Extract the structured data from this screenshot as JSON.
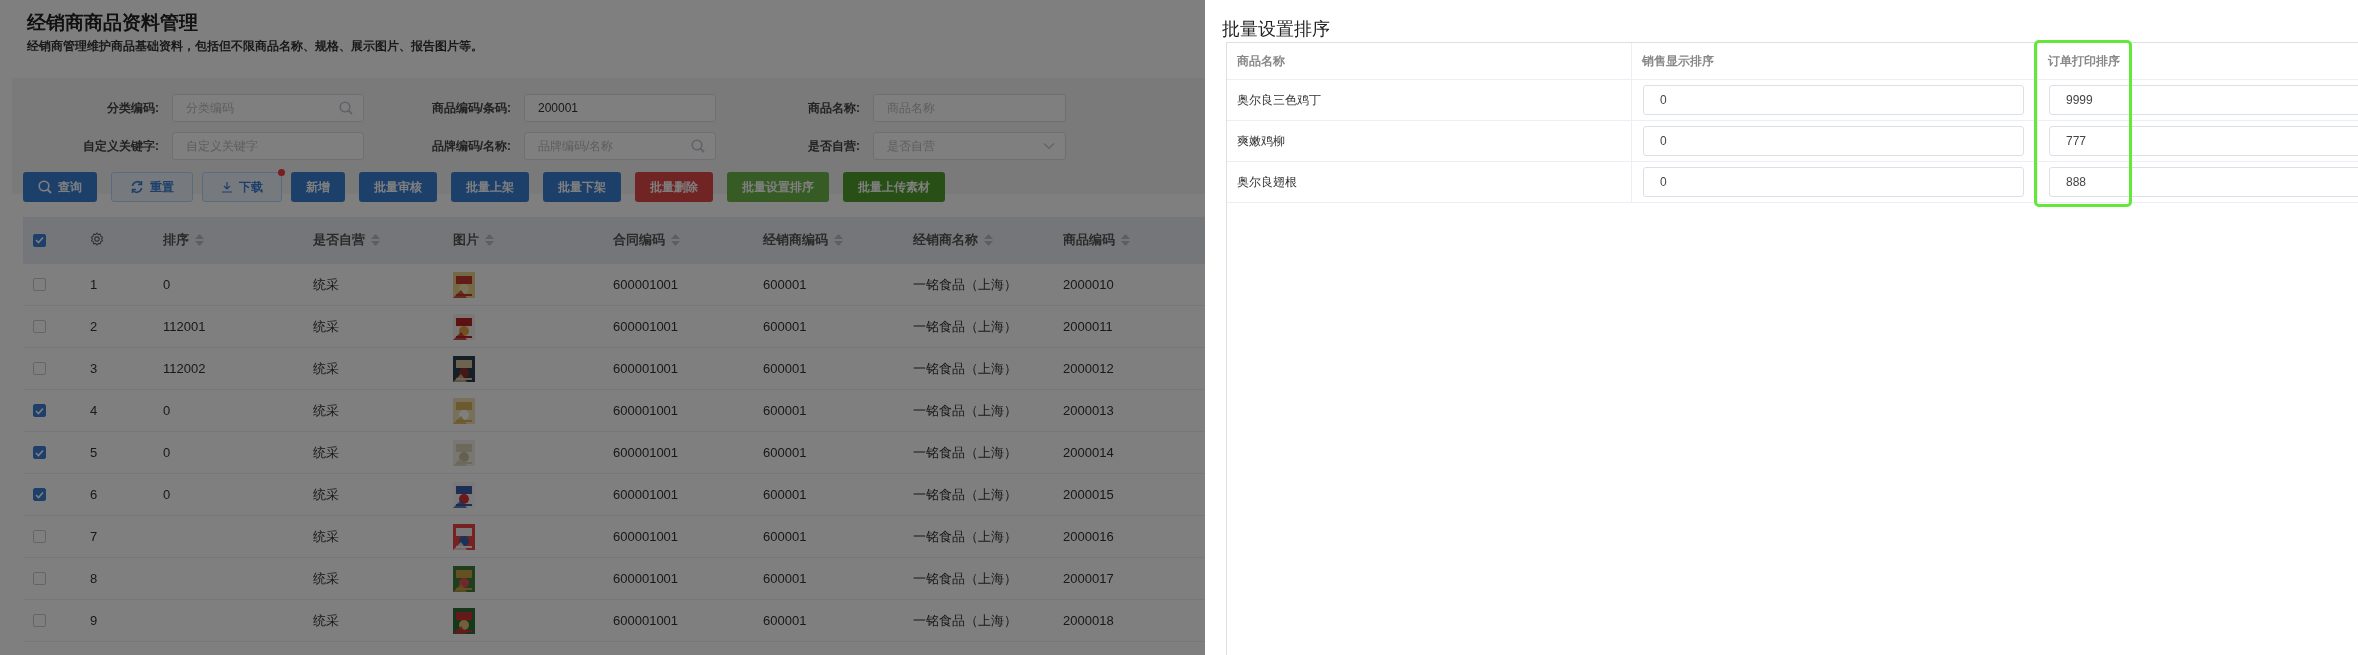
{
  "page": {
    "title": "经销商商品资料管理",
    "subtitle": "经销商管理维护商品基础资料，包括但不限商品名称、规格、展示图片、报告图片等。"
  },
  "filters": [
    {
      "label": "分类编码:",
      "placeholder": "分类编码",
      "kind": "lookup"
    },
    {
      "label": "商品编码/条码:",
      "value": "200001",
      "kind": "text"
    },
    {
      "label": "商品名称:",
      "placeholder": "商品名称",
      "kind": "text"
    },
    {
      "label": "自定义关键字:",
      "placeholder": "自定义关键字",
      "kind": "text"
    },
    {
      "label": "品牌编码/名称:",
      "placeholder": "品牌编码/名称",
      "kind": "lookup"
    },
    {
      "label": "是否自营:",
      "placeholder": "是否自营",
      "kind": "select"
    }
  ],
  "buttons": [
    {
      "label": "查询",
      "kind": "search",
      "color": "#1d406b"
    },
    {
      "label": "重置",
      "kind": "reset"
    },
    {
      "label": "下载",
      "kind": "download",
      "badge": true
    },
    {
      "label": "新增",
      "kind": "solid",
      "color": "#1d406b"
    },
    {
      "label": "批量审核",
      "kind": "solid",
      "color": "#1d406b"
    },
    {
      "label": "批量上架",
      "kind": "solid",
      "color": "#1d406b"
    },
    {
      "label": "批量下架",
      "kind": "solid",
      "color": "#1d406b"
    },
    {
      "label": "批量删除",
      "kind": "solid",
      "color": "#702424"
    },
    {
      "label": "批量设置排序",
      "kind": "solid",
      "color": "#365b25"
    },
    {
      "label": "批量上传素材",
      "kind": "solid",
      "color": "#274f16"
    }
  ],
  "table": {
    "select_all": true,
    "columns": [
      {
        "label": "排序",
        "sortable": true
      },
      {
        "label": "是否自营",
        "sortable": true
      },
      {
        "label": "图片",
        "sortable": true
      },
      {
        "label": "合同编码",
        "sortable": true
      },
      {
        "label": "经销商编码",
        "sortable": true
      },
      {
        "label": "经销商名称",
        "sortable": true
      },
      {
        "label": "商品编码",
        "sortable": true
      }
    ],
    "rows": [
      {
        "checked": false,
        "index": "1",
        "sort": "0",
        "self_run": "统采",
        "contract": "600001001",
        "dealer_code": "600001",
        "dealer_name": "一铭食品（上海）",
        "product_code": "2000010"
      },
      {
        "checked": false,
        "index": "2",
        "sort": "112001",
        "self_run": "统采",
        "contract": "600001001",
        "dealer_code": "600001",
        "dealer_name": "一铭食品（上海）",
        "product_code": "2000011"
      },
      {
        "checked": false,
        "index": "3",
        "sort": "112002",
        "self_run": "统采",
        "contract": "600001001",
        "dealer_code": "600001",
        "dealer_name": "一铭食品（上海）",
        "product_code": "2000012"
      },
      {
        "checked": true,
        "index": "4",
        "sort": "0",
        "self_run": "统采",
        "contract": "600001001",
        "dealer_code": "600001",
        "dealer_name": "一铭食品（上海）",
        "product_code": "2000013"
      },
      {
        "checked": true,
        "index": "5",
        "sort": "0",
        "self_run": "统采",
        "contract": "600001001",
        "dealer_code": "600001",
        "dealer_name": "一铭食品（上海）",
        "product_code": "2000014"
      },
      {
        "checked": true,
        "index": "6",
        "sort": "0",
        "self_run": "统采",
        "contract": "600001001",
        "dealer_code": "600001",
        "dealer_name": "一铭食品（上海）",
        "product_code": "2000015"
      },
      {
        "checked": false,
        "index": "7",
        "self_run": "统采",
        "contract": "600001001",
        "dealer_code": "600001",
        "dealer_name": "一铭食品（上海）",
        "product_code": "2000016"
      },
      {
        "checked": false,
        "index": "8",
        "self_run": "统采",
        "contract": "600001001",
        "dealer_code": "600001",
        "dealer_name": "一铭食品（上海）",
        "product_code": "2000017"
      },
      {
        "checked": false,
        "index": "9",
        "self_run": "统采",
        "contract": "600001001",
        "dealer_code": "600001",
        "dealer_name": "一铭食品（上海）",
        "product_code": "2000018"
      }
    ]
  },
  "drawer": {
    "title": "批量设置排序",
    "columns": [
      {
        "label": "商品名称",
        "highlighted": false
      },
      {
        "label": "销售显示排序",
        "highlighted": false
      },
      {
        "label": "订单打印排序",
        "highlighted": true
      }
    ],
    "rows": [
      {
        "name": "奥尔良三色鸡丁",
        "sale_order": "0",
        "print_order": "9999"
      },
      {
        "name": "爽嫩鸡柳",
        "sale_order": "0",
        "print_order": "777"
      },
      {
        "name": "奥尔良翅根",
        "sale_order": "0",
        "print_order": "888"
      }
    ]
  }
}
